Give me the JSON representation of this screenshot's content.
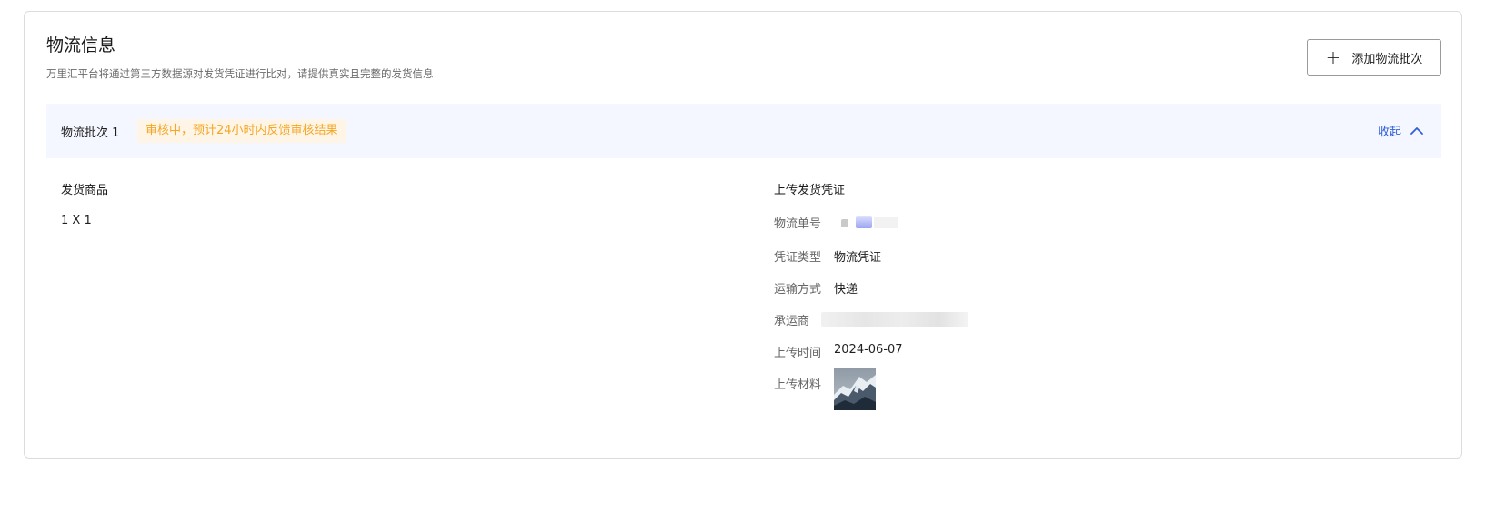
{
  "header": {
    "title": "物流信息",
    "subtitle": "万里汇平台将通过第三方数据源对发货凭证进行比对，请提供真实且完整的发货信息",
    "add_button": {
      "icon": "plus-icon",
      "label": "添加物流批次"
    }
  },
  "batch": {
    "title": "物流批次 1",
    "status": "审核中，预计24小时内反馈审核结果",
    "collapse_label": "收起",
    "collapse_icon": "chevron-up-icon"
  },
  "goods": {
    "title": "发货商品",
    "value": "1 X 1"
  },
  "upload": {
    "title": "上传发货凭证",
    "fields": {
      "tracking_number": {
        "label": "物流单号"
      },
      "voucher_type": {
        "label": "凭证类型",
        "value": "物流凭证"
      },
      "transport_method": {
        "label": "运输方式",
        "value": "快递"
      },
      "carrier": {
        "label": "承运商"
      },
      "upload_time": {
        "label": "上传时间",
        "value": "2024-06-07"
      },
      "materials": {
        "label": "上传材料",
        "thumbnail": "mountain-photo-thumbnail"
      }
    }
  },
  "colors": {
    "accent_blue": "#2f5fd9",
    "status_orange": "#f5a623",
    "status_bg": "#fff5e6",
    "batch_bar_bg": "#f4f7ff",
    "border": "#dcdcdc"
  }
}
